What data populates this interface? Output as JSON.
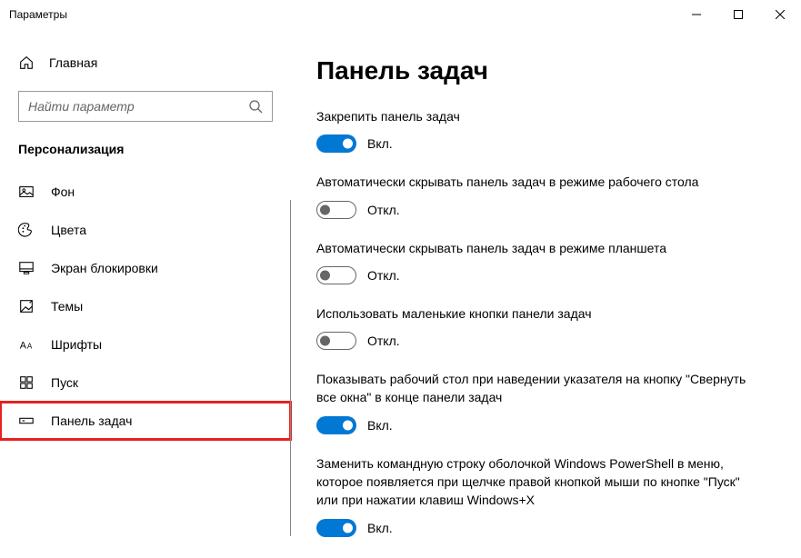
{
  "window": {
    "title": "Параметры"
  },
  "sidebar": {
    "home": "Главная",
    "search_placeholder": "Найти параметр",
    "section": "Персонализация",
    "items": [
      {
        "label": "Фон"
      },
      {
        "label": "Цвета"
      },
      {
        "label": "Экран блокировки"
      },
      {
        "label": "Темы"
      },
      {
        "label": "Шрифты"
      },
      {
        "label": "Пуск"
      },
      {
        "label": "Панель задач"
      }
    ]
  },
  "main": {
    "title": "Панель задач",
    "settings": [
      {
        "label": "Закрепить панель задач",
        "on": true,
        "state": "Вкл."
      },
      {
        "label": "Автоматически скрывать панель задач в режиме рабочего стола",
        "on": false,
        "state": "Откл."
      },
      {
        "label": "Автоматически скрывать панель задач в режиме планшета",
        "on": false,
        "state": "Откл."
      },
      {
        "label": "Использовать маленькие кнопки панели задач",
        "on": false,
        "state": "Откл."
      },
      {
        "label": "Показывать рабочий стол при наведении указателя на кнопку \"Свернуть все окна\" в конце панели задач",
        "on": true,
        "state": "Вкл."
      },
      {
        "label": "Заменить командную строку оболочкой Windows PowerShell в меню, которое появляется при щелчке правой кнопкой мыши по кнопке \"Пуск\" или при нажатии клавиш Windows+X",
        "on": true,
        "state": "Вкл."
      }
    ]
  },
  "colors": {
    "accent": "#0078d4",
    "highlight": "#e82020"
  }
}
